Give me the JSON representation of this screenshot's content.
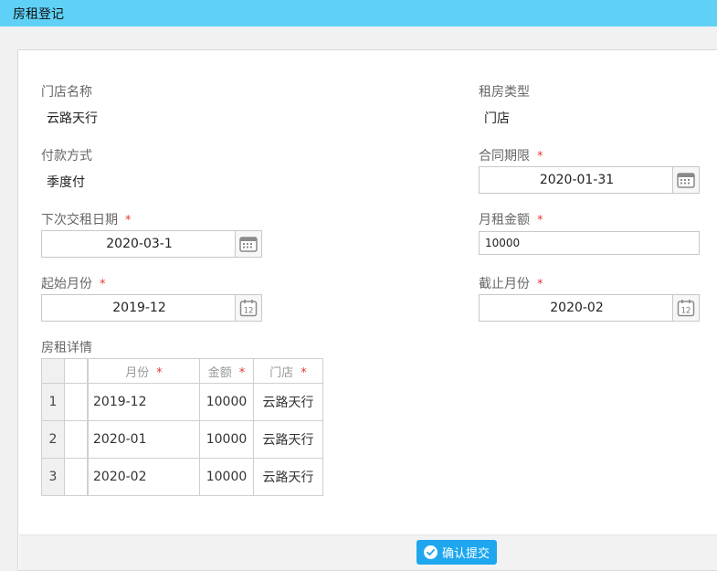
{
  "window": {
    "title": "房租登记"
  },
  "form": {
    "store_name": {
      "label": "门店名称",
      "value": "云路天行"
    },
    "rental_type": {
      "label": "租房类型",
      "value": "门店"
    },
    "payment_method": {
      "label": "付款方式",
      "value": "季度付"
    },
    "contract_end": {
      "label": "合同期限",
      "required_mark": "*",
      "value": "2020-01-31"
    },
    "next_payment_date": {
      "label": "下次交租日期",
      "required_mark": "*",
      "value": "2020-03-1"
    },
    "monthly_rent": {
      "label": "月租金额",
      "required_mark": "*",
      "value": "10000"
    },
    "start_month": {
      "label": "起始月份",
      "required_mark": "*",
      "value": "2019-12"
    },
    "end_month": {
      "label": "截止月份",
      "required_mark": "*",
      "value": "2020-02"
    }
  },
  "details": {
    "label": "房租详情",
    "columns": [
      {
        "label": "月份",
        "required_mark": "*"
      },
      {
        "label": "金额",
        "required_mark": "*"
      },
      {
        "label": "门店",
        "required_mark": "*"
      }
    ],
    "rows": [
      {
        "index": "1",
        "month": "2019-12",
        "amount": "10000",
        "store": "云路天行"
      },
      {
        "index": "2",
        "month": "2020-01",
        "amount": "10000",
        "store": "云路天行"
      },
      {
        "index": "3",
        "month": "2020-02",
        "amount": "10000",
        "store": "云路天行"
      }
    ]
  },
  "actions": {
    "submit_label": "确认提交"
  },
  "icons": {
    "calendar": "calendar-icon",
    "calendar_month": "calendar-12-icon",
    "check": "check-circle-icon"
  },
  "colors": {
    "titlebar": "#5fd1f7",
    "required": "#e53935",
    "submit": "#1ea7ef"
  }
}
